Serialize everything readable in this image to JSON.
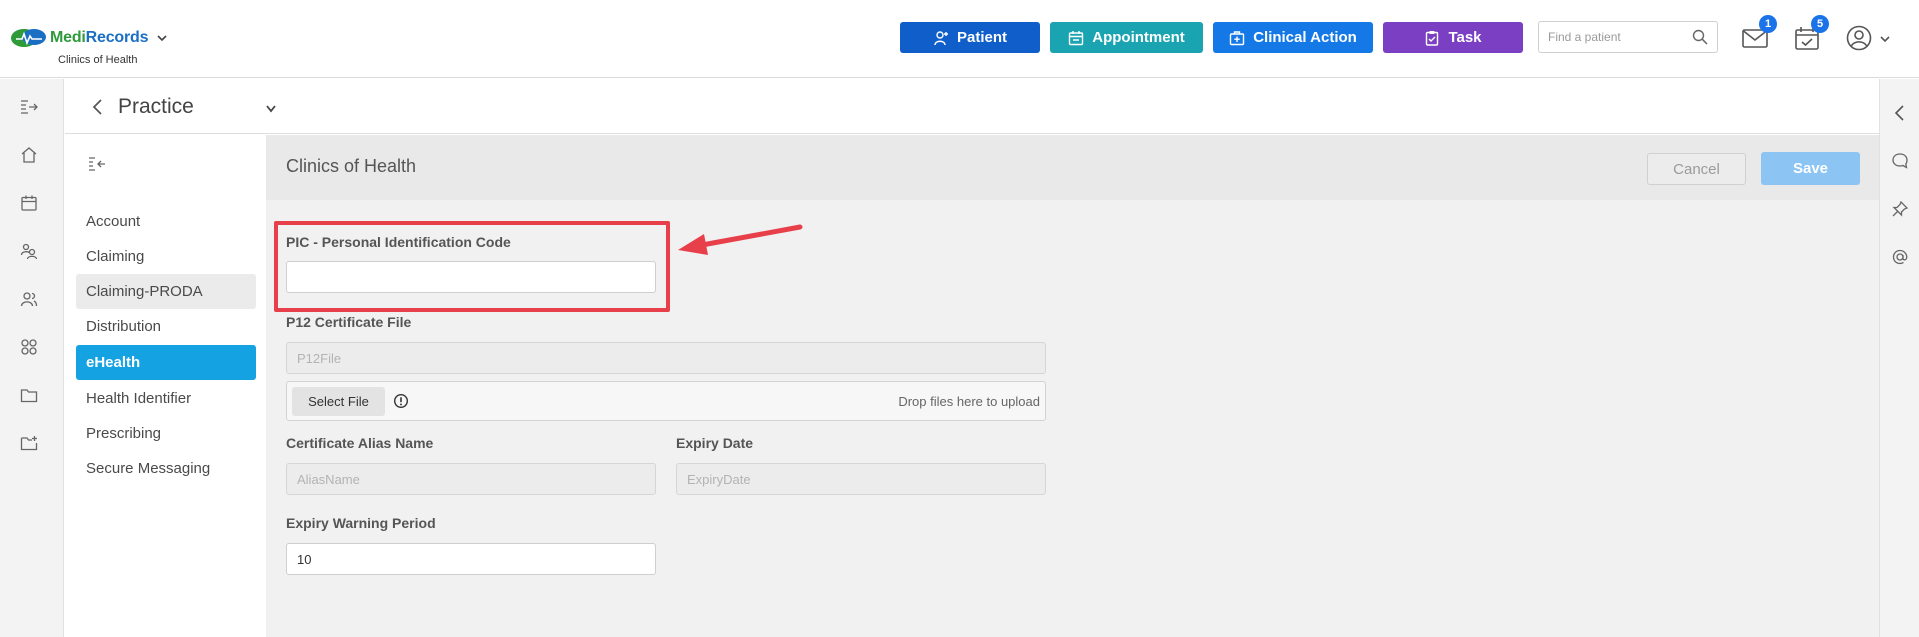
{
  "brand": {
    "name_part1": "Medi",
    "name_part2": "Records",
    "subtitle": "Clinics of Health"
  },
  "header": {
    "buttons": {
      "patient": "Patient",
      "appointment": "Appointment",
      "clinical_action": "Clinical Action",
      "task": "Task"
    },
    "search": {
      "placeholder": "Find a patient",
      "value": ""
    },
    "messages_badge": "1",
    "tasks_badge": "5"
  },
  "left_rail": {
    "icons": [
      "expand-menu-icon",
      "home-icon",
      "calendar-icon",
      "patients-icon",
      "users-icon",
      "modules-icon",
      "folder-icon",
      "folder-add-icon"
    ]
  },
  "right_rail": {
    "icons": [
      "chevron-left-icon",
      "chat-icon",
      "pin-icon",
      "at-icon"
    ]
  },
  "practice": {
    "title": "Practice"
  },
  "sidenav": {
    "items": [
      {
        "label": "Account",
        "state": "normal"
      },
      {
        "label": "Claiming",
        "state": "normal"
      },
      {
        "label": "Claiming-PRODA",
        "state": "hover"
      },
      {
        "label": "Distribution",
        "state": "normal"
      },
      {
        "label": "eHealth",
        "state": "active"
      },
      {
        "label": "Health Identifier",
        "state": "normal"
      },
      {
        "label": "Prescribing",
        "state": "normal"
      },
      {
        "label": "Secure Messaging",
        "state": "normal"
      }
    ]
  },
  "content": {
    "title": "Clinics of Health",
    "cancel_label": "Cancel",
    "save_label": "Save",
    "pic": {
      "label": "PIC - Personal Identification Code",
      "value": ""
    },
    "p12": {
      "label": "P12 Certificate File",
      "placeholder": "P12File"
    },
    "upload": {
      "select_label": "Select File",
      "drop_text": "Drop files here to upload"
    },
    "alias": {
      "label": "Certificate Alias Name",
      "placeholder": "AliasName"
    },
    "expiry": {
      "label": "Expiry Date",
      "placeholder": "ExpiryDate"
    },
    "warning": {
      "label": "Expiry Warning Period",
      "value": "10"
    }
  },
  "colors": {
    "patient": "#0f5ec9",
    "appointment": "#1aa3b0",
    "clinical_action": "#1478e6",
    "task": "#7b3fc4",
    "active_nav": "#14a2e2",
    "annotation": "#e8404a"
  }
}
